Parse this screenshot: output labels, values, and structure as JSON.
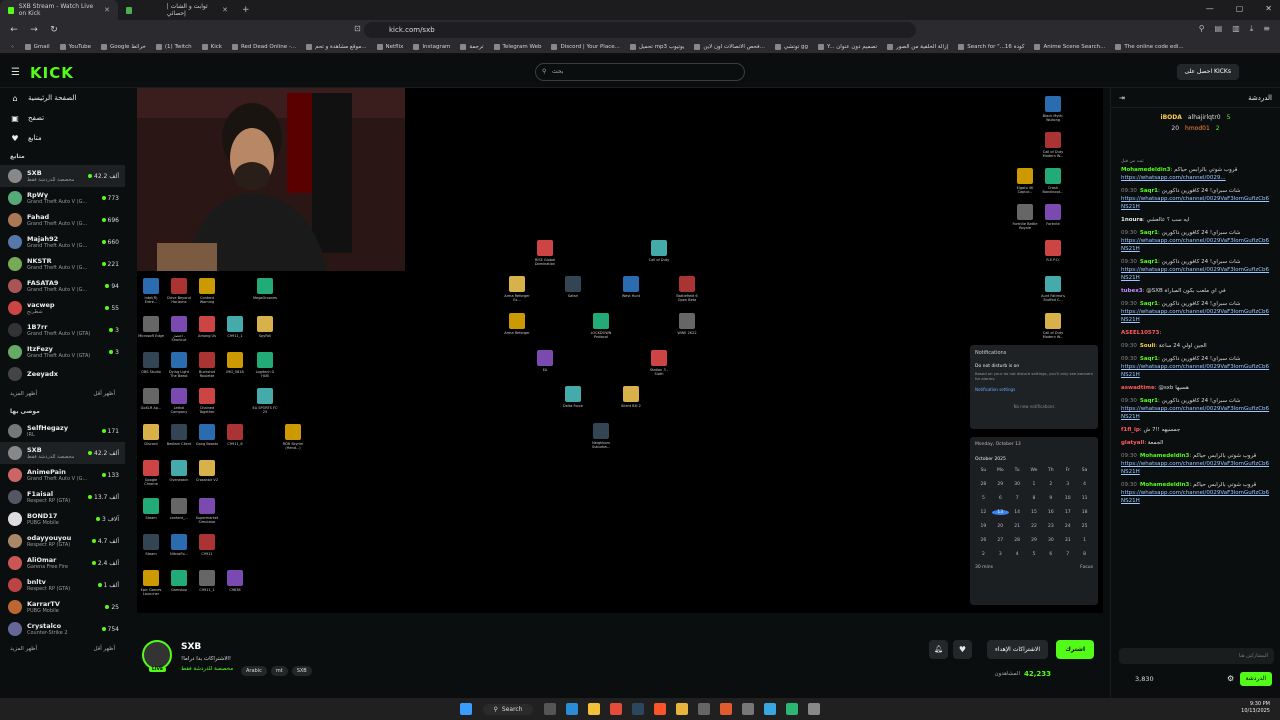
{
  "browser": {
    "tabs": [
      {
        "title": "SXB Stream - Watch Live on Kick",
        "active": true
      },
      {
        "title": "ثوابت و الشات | إحصائي",
        "active": false
      }
    ],
    "url": "kick.com/sxb",
    "bookmarks": [
      "Gmail",
      "YouTube",
      "Google خرائط",
      "(1) Twitch",
      "Kick",
      "Red Dead Online -...",
      "موقع مشاهدة و تحم...",
      "Netflix",
      "Instagram",
      "ترجمة",
      "Telegram Web",
      "Discord | Your Place...",
      "تحميل mp3 يوتيوب",
      "فحص الاتصالات اون لاين...",
      "توتشي gg",
      "Y... تصميم دون عنوان",
      "إزالة الخلفية من الصور",
      "Search for \"...16 كودة",
      "Anime Scene Search...",
      "The online code edi..."
    ]
  },
  "header": {
    "logo": "KICK",
    "search_placeholder": "بحث",
    "login_label": "احصل على KICKs"
  },
  "sidebar": {
    "nav": [
      {
        "label": "الصفحة الرئيسية",
        "icon": "home-icon",
        "glyph": "⌂"
      },
      {
        "label": "تصفح",
        "icon": "browse-icon",
        "glyph": "▣"
      },
      {
        "label": "متابع",
        "icon": "heart-icon",
        "glyph": "♥"
      }
    ],
    "following_heading": "متابع",
    "following": [
      {
        "name": "SXB",
        "game": "مخصصة للدردشة فقط",
        "count": "42.2 ألف",
        "color": "#888",
        "selected": true
      },
      {
        "name": "RpWy",
        "game": "Grand Theft Auto V (G...",
        "count": "773",
        "color": "#5a7"
      },
      {
        "name": "Fahad",
        "game": "Grand Theft Auto V (G...",
        "count": "696",
        "color": "#a75"
      },
      {
        "name": "Majah92",
        "game": "Grand Theft Auto V (G...",
        "count": "660",
        "color": "#57a"
      },
      {
        "name": "NKSTR",
        "game": "Grand Theft Auto V (G...",
        "count": "221",
        "color": "#7a5"
      },
      {
        "name": "FASATA9",
        "game": "Grand Theft Auto V (G...",
        "count": "94",
        "color": "#a55"
      },
      {
        "name": "vacwep",
        "game": "شطرنج",
        "count": "55",
        "color": "#c44"
      },
      {
        "name": "1B7rr",
        "game": "Grand Theft Auto V (GTA)",
        "count": "3",
        "color": "#333"
      },
      {
        "name": "ItzFezy",
        "game": "Grand Theft Auto V (GTA)",
        "count": "3",
        "color": "#6a6"
      },
      {
        "name": "Zeeyadx",
        "game": "",
        "count": "",
        "color": "#444"
      }
    ],
    "show_more": "أظهر المزيد",
    "show_less": "أظهر أقل",
    "recommended_heading": "موصى بها",
    "recommended": [
      {
        "name": "SelfHegazy",
        "game": "IRL",
        "count": "171",
        "color": "#777"
      },
      {
        "name": "SXB",
        "game": "مخصصة للدردشة فقط",
        "count": "42.2 ألف",
        "color": "#888",
        "selected": true
      },
      {
        "name": "AnimePain",
        "game": "Grand Theft Auto V (G...",
        "count": "133",
        "color": "#c66"
      },
      {
        "name": "F1aisal",
        "game": "Respect RP (GTA)",
        "count": "13.7 ألف",
        "color": "#556"
      },
      {
        "name": "BOND17",
        "game": "PUBG Mobile",
        "count": "3 آلاف",
        "color": "#ddd"
      },
      {
        "name": "odayyouyou",
        "game": "Respect RP (GTA)",
        "count": "4.7 ألف",
        "color": "#a86"
      },
      {
        "name": "AliOmar",
        "game": "Garena Free Fire",
        "count": "2.4 ألف",
        "color": "#c55"
      },
      {
        "name": "bnltv",
        "game": "Respect RP (GTA)",
        "count": "1 ألف",
        "color": "#b44"
      },
      {
        "name": "KarrarTV",
        "game": "PUBG Mobile",
        "count": "25",
        "color": "#b63"
      },
      {
        "name": "Crystalco",
        "game": "Counter-Strike 2",
        "count": "754",
        "color": "#669"
      }
    ]
  },
  "desktop": {
    "icons": [
      "Intel(R) Extre...",
      "Drive Beyond Horizons",
      "Content Warning",
      "MegaGrooves",
      "Microsoft Edge",
      "اختصار - Shortcut",
      "Among Us",
      "C9911_1",
      "SpyFall",
      "OBS Studio",
      "Dying Light The Beast",
      "Buckshot Roulette",
      "IMG_5818",
      "Logitech G HUB",
      "GoXLR Ap...",
      "Lethal Company",
      "Chained Together",
      "EA SPORTS FC 25",
      "Discord",
      "Bedlam Client",
      "Gang Beasts",
      "C9911_6",
      "RDR Skyrim (Hend...)",
      "Steam",
      "content_...",
      "Supermarket Simulator",
      "Google Chrome",
      "Overwatch",
      "Crosshair V2",
      "Steam",
      "NitroxFo...",
      "C9911",
      "Epic Games Launcher",
      "Gamstop",
      "C9911_1",
      "C9838",
      "RISE Global Domination",
      "Call of Duty",
      "Arma Reforger Ex...",
      "Safari",
      "West Hunt",
      "Battlefield 6 Open Beta",
      "Arma Reforger",
      "LOCKDOWN Protocol",
      "WWE 2K22",
      "EA",
      "Station 3 - Sloth",
      "Delta Force",
      "Silent Bill 2",
      "Neighbors Suburba...",
      "Black Myth: Wukong",
      "Call of Duty Modern W...",
      "Elgato 4K Captur...",
      "Crash Bandicoot...",
      "Fortnite Battle Royale",
      "Fortnite",
      "R.E.P.O.",
      "Aunt Fatima's Stuffed C...",
      "Call of Duty Modern W..."
    ],
    "notif_title": "Notifications",
    "dnd": "Do not disturb is on",
    "dnd_desc": "Based on your do not disturb settings, you'll only see banners for alarms.",
    "notif_settings": "Notification settings",
    "no_notif": "No new notifications",
    "cal_date": "Monday, October 13",
    "cal_month": "October 2025",
    "cal_days": [
      "Su",
      "Mo",
      "Tu",
      "We",
      "Th",
      "Fr",
      "Sa"
    ],
    "cal_cells": [
      "28",
      "29",
      "30",
      "1",
      "2",
      "3",
      "4",
      "5",
      "6",
      "7",
      "8",
      "9",
      "10",
      "11",
      "12",
      "13",
      "14",
      "15",
      "16",
      "17",
      "18",
      "19",
      "20",
      "21",
      "22",
      "23",
      "24",
      "25",
      "26",
      "27",
      "28",
      "29",
      "30",
      "31",
      "1",
      "2",
      "3",
      "4",
      "5",
      "6",
      "7",
      "8"
    ],
    "cal_today_index": 15,
    "focus_time": "30 mins",
    "focus_btn": "Focus"
  },
  "stream": {
    "name": "SXB",
    "title": "!الاشتراكات بدا دراما!",
    "category": "مخصصة للدردشة فقط",
    "tags": [
      "Arabic",
      "mt",
      "SXB"
    ],
    "live_label": "LIVE",
    "subscribe_label": "اشترك",
    "gift_label": "الاشتراكات الإهداء",
    "viewers": "42,233",
    "viewers_label": "المشاهدون"
  },
  "chat": {
    "title": "الدردشة",
    "leaderboard": [
      {
        "name": "iBODA",
        "value": "20",
        "user2": "alhajirlqtr0",
        "value2": "5"
      },
      {
        "name": "hmod01",
        "value": "2"
      }
    ],
    "pinned_by": "ثبت من قبل",
    "messages": [
      {
        "time": "",
        "user": "Mohamedeldin3",
        "ucolor": "#53fc18",
        "text": "قروب شوتي بالرابس حياكم",
        "link": "https://whatsapp.com/channel/0029..."
      },
      {
        "time": "09:30",
        "user": "Saqr1",
        "ucolor": "#53fc18",
        "text": "شات سبراي! 24 كافورين داكورين",
        "link": "https://whatsapp.com/channel/0029VaF3lomGufIzCb6NS21H"
      },
      {
        "time": "",
        "user": "1noura",
        "ucolor": "#e8e8e8",
        "text": "ايه سب ؟ عالعشي",
        "link": ""
      },
      {
        "time": "09:30",
        "user": "Saqr1",
        "ucolor": "#53fc18",
        "text": "شات سبراي! 24 كافورين داكورين",
        "link": "https://whatsapp.com/channel/0029VaF3lomGufIzCb6NS21H"
      },
      {
        "time": "09:30",
        "user": "Saqr1",
        "ucolor": "#53fc18",
        "text": "شات سبراي! 24 كافورين داكورين",
        "link": "https://whatsapp.com/channel/0029VaF3lomGufIzCb6NS21H"
      },
      {
        "time": "",
        "user": "tubex3",
        "ucolor": "#c58bff",
        "text": "@SXB في اي ملعب بكون المباراة",
        "link": ""
      },
      {
        "time": "09:30",
        "user": "Saqr1",
        "ucolor": "#53fc18",
        "text": "شات سبراي! 24 كافورين داكورين",
        "link": "https://whatsapp.com/channel/0029VaF3lomGufIzCb6NS21H"
      },
      {
        "time": "",
        "user": "ASEEL10573",
        "ucolor": "#ff5c5c",
        "text": "",
        "link": ""
      },
      {
        "time": "09:30",
        "user": "Souli",
        "ucolor": "#ffd04d",
        "text": "الجين اولي 24 ساعة",
        "link": ""
      },
      {
        "time": "09:30",
        "user": "Saqr1",
        "ucolor": "#53fc18",
        "text": "شات سبراي! 24 كافورين داكورين",
        "link": "https://whatsapp.com/channel/0029VaF3lomGufIzCb6NS21H"
      },
      {
        "time": "",
        "user": "aswadtime",
        "ucolor": "#ff5c5c",
        "text": "@sxb هسيها",
        "link": ""
      },
      {
        "time": "09:30",
        "user": "Saqr1",
        "ucolor": "#53fc18",
        "text": "شات سبراي! 24 كافورين داكورين",
        "link": "https://whatsapp.com/channel/0029VaF3lomGufIzCb6NS21H"
      },
      {
        "time": "",
        "user": "f1fl_ip",
        "ucolor": "#ff5c5c",
        "text": "جمسيهه !!7 ش",
        "link": ""
      },
      {
        "time": "",
        "user": "glatyall",
        "ucolor": "#ff5c5c",
        "text": "الجمعة",
        "link": ""
      },
      {
        "time": "09:30",
        "user": "Mohamedeldin3",
        "ucolor": "#53fc18",
        "text": "قروب شوتي بالرابس حياكم",
        "link": "https://whatsapp.com/channel/0029VaF3lomGufIzCb6NS21H"
      },
      {
        "time": "09:30",
        "user": "Mohamedeldin3",
        "ucolor": "#53fc18",
        "text": "قروب شوتي بالرابس حياكم",
        "link": "https://whatsapp.com/channel/0029VaF3lomGufIzCb6NS21H"
      }
    ],
    "input_placeholder": "المشاركين هنا",
    "points": "3,830",
    "send_label": "الدردشة"
  },
  "taskbar": {
    "search_label": "Search",
    "time": "9:30 PM",
    "date": "10/13/2025"
  },
  "colors": {
    "accent": "#53fc18",
    "bg": "#0b0e0f",
    "panel": "#24272a"
  }
}
